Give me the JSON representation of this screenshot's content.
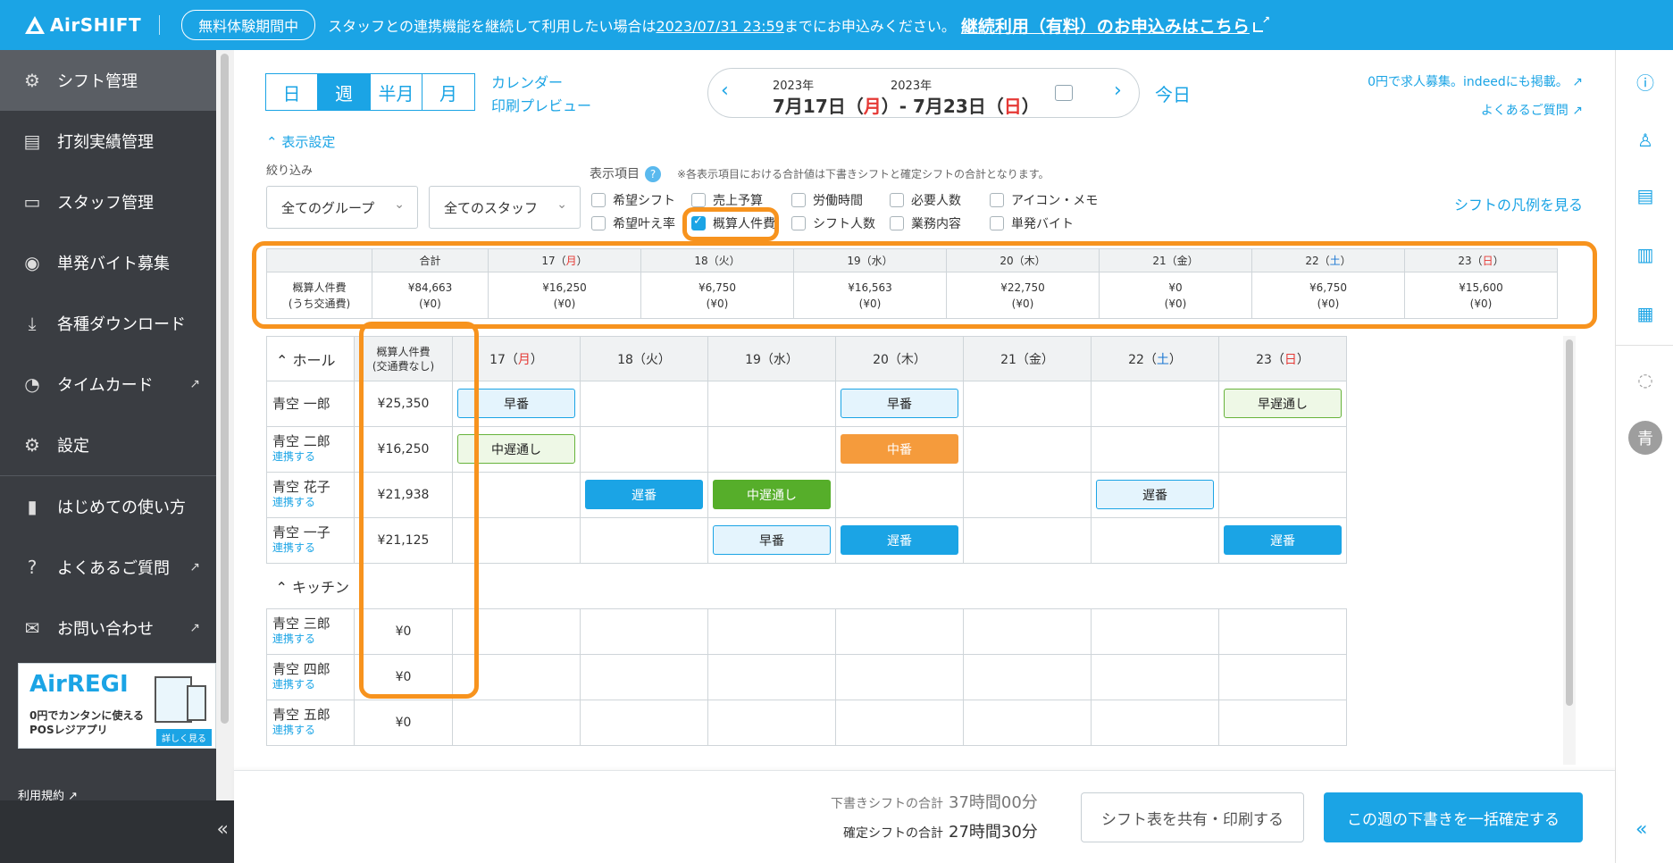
{
  "banner": {
    "logo": "AirSHIFT",
    "trial": "無料体験期間中",
    "msg_before": "スタッフとの連携機能を継続して利用したい場合は",
    "deadline": "2023/07/31 23:59",
    "msg_after": "までにお申込みください。",
    "link": "継続利用（有料）のお申込みはこちら"
  },
  "sidebar": {
    "items": [
      {
        "label": "シフト管理",
        "icon": "shift-icon"
      },
      {
        "label": "打刻実績管理",
        "icon": "clock-record-icon"
      },
      {
        "label": "スタッフ管理",
        "icon": "staff-card-icon"
      },
      {
        "label": "単発バイト募集",
        "icon": "search-person-icon"
      },
      {
        "label": "各種ダウンロード",
        "icon": "download-icon"
      },
      {
        "label": "タイムカード",
        "icon": "timecard-icon"
      },
      {
        "label": "設定",
        "icon": "gear-icon"
      },
      {
        "label": "はじめての使い方",
        "icon": "book-icon"
      },
      {
        "label": "よくあるご質問",
        "icon": "question-icon"
      },
      {
        "label": "お問い合わせ",
        "icon": "mail-icon"
      }
    ],
    "ad": {
      "title": "AirREGI",
      "line1": "0円でカンタンに使える",
      "line2": "POSレジアプリ",
      "button": "詳しく見る"
    },
    "terms": "利用規約",
    "collapse": "«"
  },
  "toolbar": {
    "views": [
      "日",
      "週",
      "半月",
      "月"
    ],
    "active_view": "週",
    "calendar_link": "カレンダー",
    "print_link": "印刷プレビュー",
    "year1": "2023年",
    "year2": "2023年",
    "start_date": "7月17日（",
    "start_dow": "月",
    "end_date": "7月23日（",
    "end_dow": "日",
    "today": "今日",
    "promo": "0円で求人募集。indeedにも掲載。",
    "faq": "よくあるご質問"
  },
  "settings": {
    "toggle": "表示設定",
    "filter_label": "絞り込み",
    "group_select": "全てのグループ",
    "staff_select": "全てのスタッフ",
    "display_label": "表示項目",
    "note": "※各表示項目における合計値は下書きシフトと確定シフトの合計となります。",
    "checkboxes": [
      {
        "label": "希望シフト",
        "checked": false
      },
      {
        "label": "売上予算",
        "checked": false
      },
      {
        "label": "労働時間",
        "checked": false
      },
      {
        "label": "必要人数",
        "checked": false
      },
      {
        "label": "アイコン・メモ",
        "checked": false
      },
      {
        "label": "希望叶え率",
        "checked": false
      },
      {
        "label": "概算人件費",
        "checked": true
      },
      {
        "label": "シフト人数",
        "checked": false
      },
      {
        "label": "業務内容",
        "checked": false
      },
      {
        "label": "単発バイト",
        "checked": false
      }
    ],
    "legend_link": "シフトの凡例を見る"
  },
  "summary": {
    "headers": [
      "合計",
      "17（月）",
      "18（火）",
      "19（水）",
      "20（木）",
      "21（金）",
      "22（土）",
      "23（日）"
    ],
    "row_label1": "概算人件費",
    "row_label2": "(うち交通費)",
    "values": [
      "¥84,663",
      "¥16,250",
      "¥6,750",
      "¥16,563",
      "¥22,750",
      "¥0",
      "¥6,750",
      "¥15,600"
    ],
    "sub_values": [
      "(¥0)",
      "(¥0)",
      "(¥0)",
      "(¥0)",
      "(¥0)",
      "(¥0)",
      "(¥0)",
      "(¥0)"
    ]
  },
  "shift": {
    "hall_group": "ホール",
    "kitchen_group": "キッチン",
    "cost_header1": "概算人件費",
    "cost_header2": "(交通費なし)",
    "days": [
      {
        "num": "17",
        "dow": "月"
      },
      {
        "num": "18",
        "dow": "火"
      },
      {
        "num": "19",
        "dow": "水"
      },
      {
        "num": "20",
        "dow": "木"
      },
      {
        "num": "21",
        "dow": "金"
      },
      {
        "num": "22",
        "dow": "土"
      },
      {
        "num": "23",
        "dow": "日"
      }
    ],
    "link_text": "連携する",
    "hall_staff": [
      {
        "name": "青空 一郎",
        "linked": true,
        "cost": "¥25,350"
      },
      {
        "name": "青空 二郎",
        "linked": false,
        "cost": "¥16,250"
      },
      {
        "name": "青空 花子",
        "linked": false,
        "cost": "¥21,938"
      },
      {
        "name": "青空 一子",
        "linked": false,
        "cost": "¥21,125"
      }
    ],
    "kitchen_staff": [
      {
        "name": "青空 三郎",
        "cost": "¥0"
      },
      {
        "name": "青空 四郎",
        "cost": "¥0"
      },
      {
        "name": "青空 五郎",
        "cost": "¥0"
      }
    ],
    "shifts": {
      "ichiro_mon": "早番",
      "ichiro_thu": "早番",
      "ichiro_sun": "早遅通し",
      "jiro_mon": "中遅通し",
      "jiro_thu": "中番",
      "hanako_tue": "遅番",
      "hanako_wed": "中遅通し",
      "hanako_sat": "遅番",
      "ichiko_wed": "早番",
      "ichiko_thu": "遅番",
      "ichiko_sun": "遅番"
    }
  },
  "footer": {
    "draft_label": "下書きシフトの合計",
    "draft_value": "37時間00分",
    "confirmed_label": "確定シフトの合計",
    "confirmed_value": "27時間30分",
    "share_button": "シフト表を共有・印刷する",
    "confirm_button": "この週の下書きを一括確定する"
  },
  "rightrail": {
    "avatar": "青",
    "collapse": "«"
  },
  "colors": {
    "accent": "#1ba4e5",
    "highlight": "#f7931e",
    "sidebar": "#3a3d42"
  }
}
